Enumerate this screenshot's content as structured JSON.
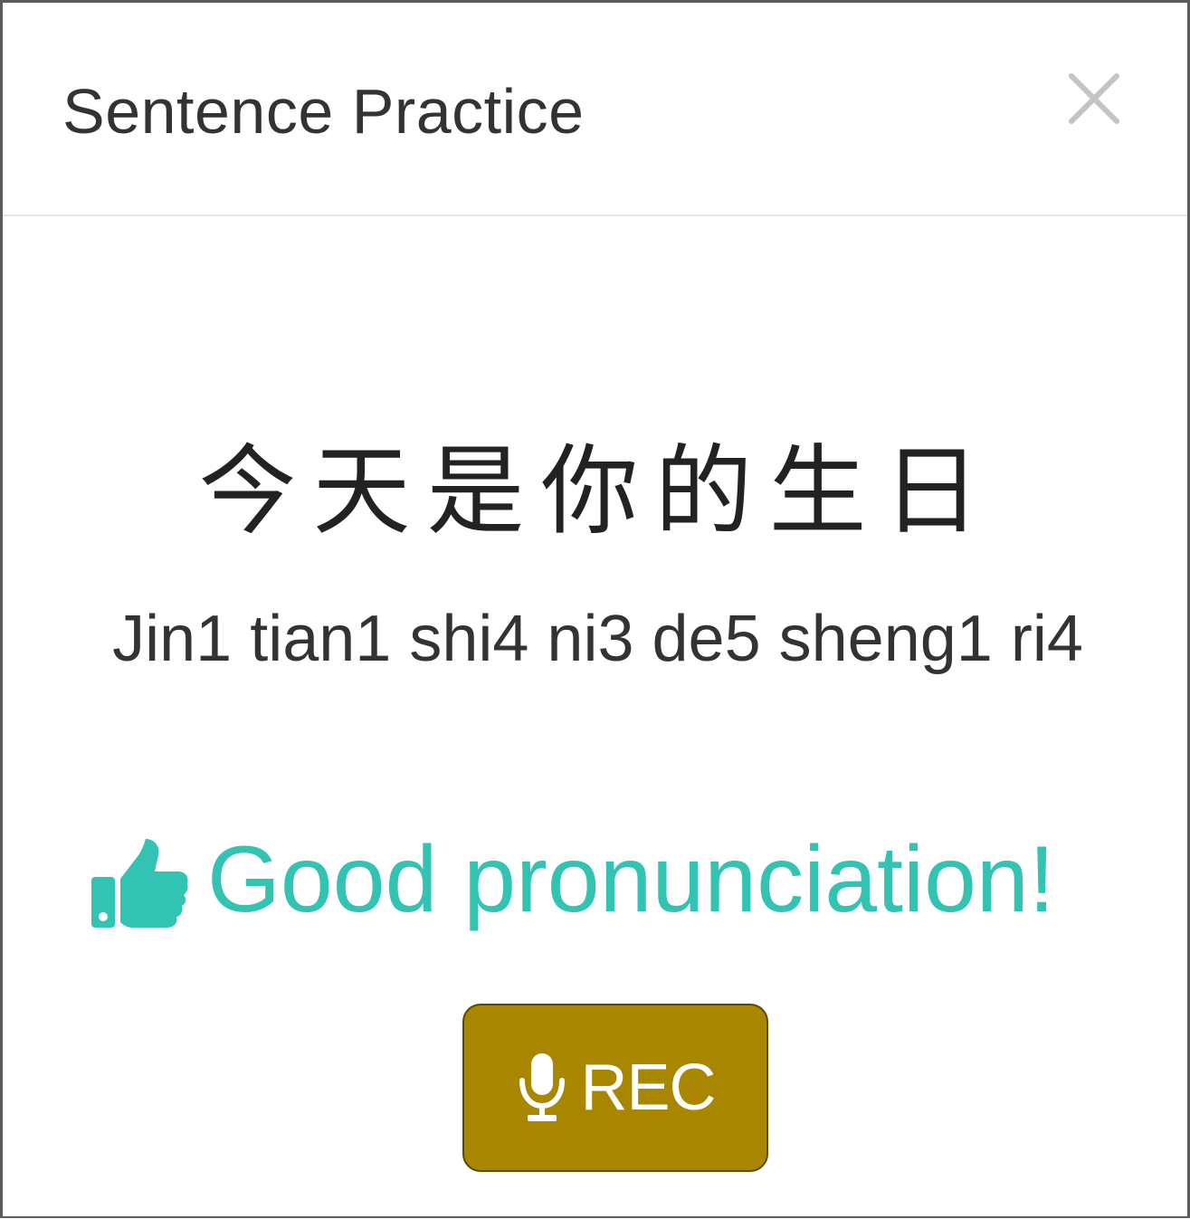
{
  "dialog": {
    "title": "Sentence Practice",
    "close_icon": "close-icon"
  },
  "sentence": {
    "hanzi": "今天是你的生日",
    "pinyin": "Jin1 tian1 shi4 ni3 de5 sheng1 ri4"
  },
  "feedback": {
    "icon": "thumbs-up-icon",
    "text": "Good pronunciation!",
    "color": "#33c3b3"
  },
  "record_button": {
    "icon": "microphone-icon",
    "label": "REC",
    "color": "#a98600"
  }
}
